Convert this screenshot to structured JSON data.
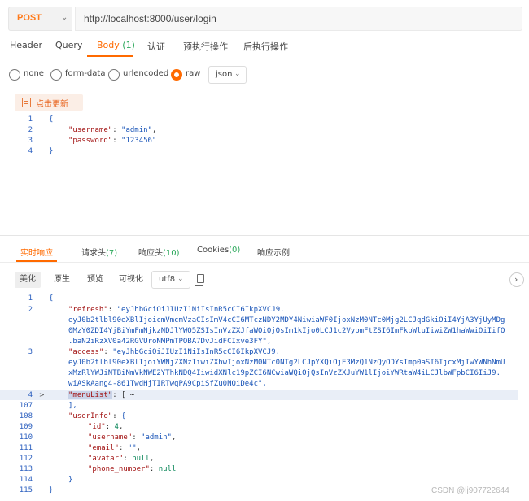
{
  "request": {
    "method": "POST",
    "url": "http://localhost:8000/user/login",
    "tabs": [
      {
        "label": "Header",
        "count": ""
      },
      {
        "label": "Query",
        "count": ""
      },
      {
        "label": "Body",
        "count": "(1)"
      },
      {
        "label": "认证",
        "count": ""
      },
      {
        "label": "预执行操作",
        "count": ""
      },
      {
        "label": "后执行操作",
        "count": ""
      }
    ],
    "active_tab": "Body",
    "body_types": [
      "none",
      "form-data",
      "urlencoded",
      "raw"
    ],
    "selected_body_type": "raw",
    "format": "json",
    "update_button": "点击更新",
    "body_lines": [
      {
        "n": "1",
        "text": "{"
      },
      {
        "n": "2",
        "key": "\"username\"",
        "value": "\"admin\""
      },
      {
        "n": "3",
        "key": "\"password\"",
        "value": "\"123456\""
      },
      {
        "n": "4",
        "text": "}"
      }
    ]
  },
  "response": {
    "tabs": [
      {
        "label": "实时响应",
        "count": ""
      },
      {
        "label": "请求头",
        "count": "(7)"
      },
      {
        "label": "响应头",
        "count": "(10)"
      },
      {
        "label": "Cookies",
        "count": "(0)"
      },
      {
        "label": "响应示例",
        "count": ""
      }
    ],
    "active_tab": "实时响应",
    "view_buttons": [
      "美化",
      "原生",
      "预览",
      "可视化"
    ],
    "active_view": "美化",
    "encoding": "utf8",
    "line_numbers": [
      "1",
      "2",
      "",
      "",
      "",
      "3",
      "",
      "",
      "",
      "4",
      "107",
      "108",
      "109",
      "110",
      "111",
      "112",
      "113",
      "114",
      "115"
    ],
    "refresh_key": "\"refresh\"",
    "refresh_value_lines": [
      "\"eyJhbGciOiJIUzI1NiIsInR5cCI6IkpXVCJ9.",
      "eyJ0b2tlbl90eXBlIjoicmVmcmVzaCIsImV4cCI6MTczNDY2MDY4NiwiaWF0IjoxNzM0NTc0Mjg2LCJqdGkiOiI4YjA3YjUyMDg",
      "0MzY0ZDI4YjBiYmFmNjkzNDJlYWQ5ZSIsInVzZXJfaWQiOjQsIm1kIjo0LCJ1c2VybmFtZSI6ImFkbWluIiwiZW1haWwiOiIifQ",
      ".baN2iRzXV0a42RGVUroNMPmTPOBA7DvJidFCIxve3FY\","
    ],
    "access_key": "\"access\"",
    "access_value_lines": [
      "\"eyJhbGciOiJIUzI1NiIsInR5cCI6IkpXVCJ9.",
      "eyJ0b2tlbl90eXBlIjoiYWNjZXNzIiwiZXhwIjoxNzM0NTc0NTg2LCJpYXQiOjE3MzQ1NzQyODYsImp0aSI6IjcxMjIwYWNhNmU",
      "xMzRlYWJiNTBiNmVkNWE2YThkNDQ4IiwidXNlc19pZCI6NCwiaWQiOjQsInVzZXJuYW1lIjoiYWRtaW4iLCJlbWFpbCI6IiJ9.",
      "wiASkAang4-861TwdHjTIRTwqPA9CpiSfZu0NQiDe4c\","
    ],
    "menu_key": "\"menuList\"",
    "menu_folded": "[ ⋯",
    "close_bracket_comma": "],",
    "userinfo_key": "\"userInfo\"",
    "userinfo_fields": [
      {
        "key": "\"id\"",
        "value": "4",
        "type": "num",
        "comma": ","
      },
      {
        "key": "\"username\"",
        "value": "\"admin\"",
        "type": "str",
        "comma": ","
      },
      {
        "key": "\"email\"",
        "value": "\"\"",
        "type": "str",
        "comma": ","
      },
      {
        "key": "\"avatar\"",
        "value": "null",
        "type": "num",
        "comma": ","
      },
      {
        "key": "\"phone_number\"",
        "value": "null",
        "type": "num",
        "comma": ""
      }
    ],
    "open_brace": "{",
    "close_brace": "}"
  },
  "watermark": "CSDN @lj907722644"
}
